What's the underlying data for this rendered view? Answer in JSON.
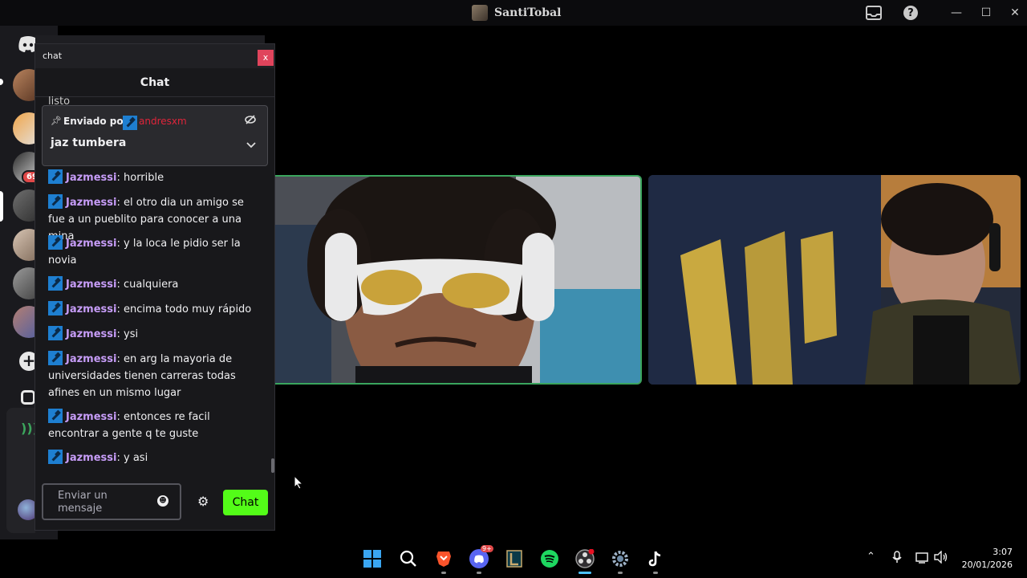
{
  "window": {
    "title": "SantiTobal",
    "minimize": "—",
    "maximize": "☐",
    "close": "✕"
  },
  "sidebar": {
    "badge_count": "69",
    "add_server": "+"
  },
  "chat_popup": {
    "window_title": "chat",
    "close_label": "x",
    "header": "Chat",
    "faded_message": "listo",
    "pinned": {
      "sent_by_label": "Enviado por",
      "sent_by_user": "andresxm",
      "text": "jaz tumbera"
    },
    "messages": [
      {
        "user": "Jazmessi",
        "text": "horrible"
      },
      {
        "user": "Jazmessi",
        "text": "el otro dia un amigo se fue a un pueblito para conocer a una mina"
      },
      {
        "user": "Jazmessi",
        "text": "y la loca le pidio ser la novia"
      },
      {
        "user": "Jazmessi",
        "text": "cualquiera"
      },
      {
        "user": "Jazmessi",
        "text": "encima todo muy rápido"
      },
      {
        "user": "Jazmessi",
        "text": "ysi"
      },
      {
        "user": "Jazmessi",
        "text": "en arg la mayoria de universidades tienen carreras todas afines en un mismo lugar"
      },
      {
        "user": "Jazmessi",
        "text": "entonces re facil encontrar a gente q te guste"
      },
      {
        "user": "Jazmessi",
        "text": "y asi"
      }
    ],
    "input_placeholder": "Enviar un mensaje",
    "send_button": "Chat"
  },
  "taskbar": {
    "discord_badge": "9+",
    "time": "3:07",
    "date": "20/01/2026"
  },
  "colors": {
    "accent_green": "#53fc18",
    "username_purple": "#c69cf7",
    "pinned_user_red": "#e0243a",
    "speaking_border": "#3aa55d"
  }
}
